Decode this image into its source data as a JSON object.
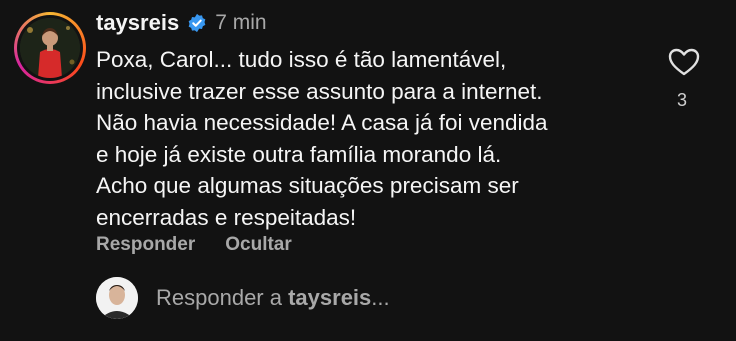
{
  "comment": {
    "username": "taysreis",
    "time": "7 min",
    "lines": [
      "Poxa, Carol... tudo isso é tão lamentável,",
      "inclusive trazer esse assunto para a internet.",
      "Não havia necessidade! A casa já foi vendida",
      "e hoje já existe outra família morando lá.",
      "Acho que algumas situações precisam ser",
      "encerradas e respeitadas!"
    ],
    "likes": "3",
    "reply_label": "Responder",
    "hide_label": "Ocultar"
  },
  "reply_box": {
    "prefix": "Responder a ",
    "username": "taysreis",
    "suffix": "..."
  },
  "colors": {
    "background": "#121212",
    "verified": "#3897f0",
    "muted_text": "#a8a8a8"
  },
  "icons": [
    "verified-badge-icon",
    "heart-icon"
  ]
}
